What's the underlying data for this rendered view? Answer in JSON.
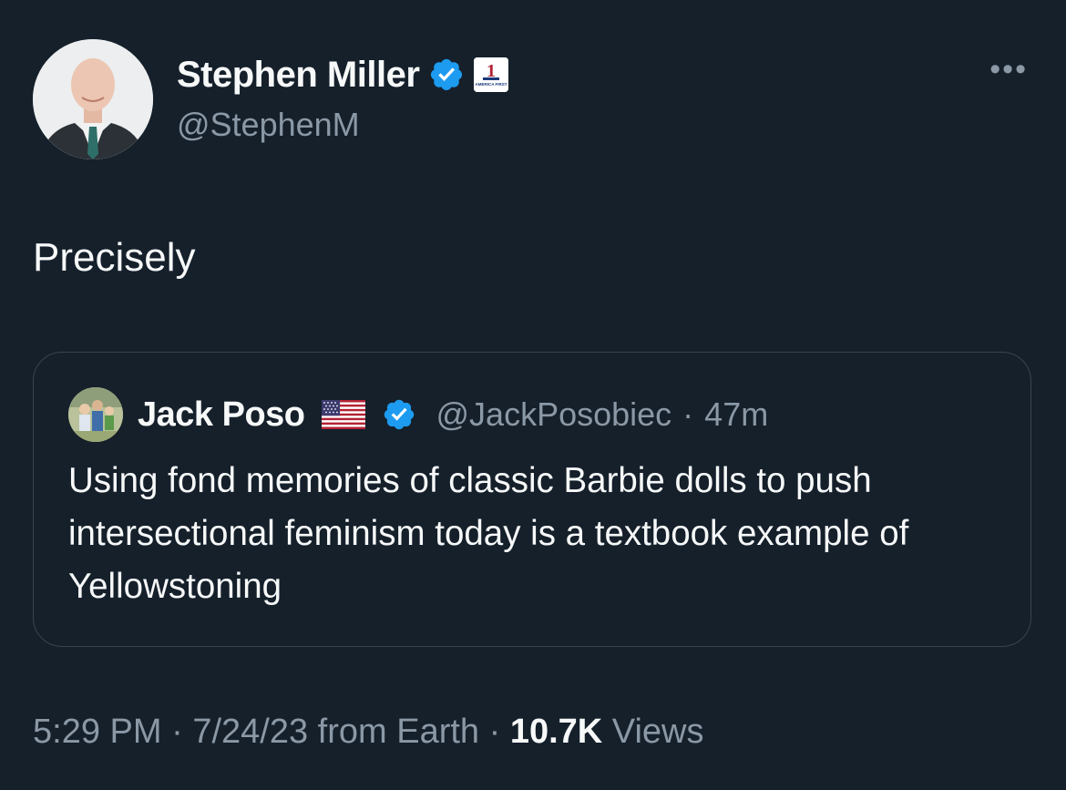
{
  "author": {
    "display_name": "Stephen Miller",
    "handle": "@StephenM",
    "verified_icon": "verified-badge-icon",
    "affiliate_badge_text": "AMERICA FIRST",
    "affiliate_badge_number": "1"
  },
  "tweet": {
    "text": "Precisely"
  },
  "quoted": {
    "display_name": "Jack Poso",
    "flag_icon": "us-flag-icon",
    "handle": "@JackPosobiec",
    "separator": "·",
    "time": "47m",
    "text": "Using fond memories of classic Barbie dolls to push intersectional feminism today is a textbook example of Yellowstoning"
  },
  "meta": {
    "time": "5:29 PM",
    "sep1": " · ",
    "date": "7/24/23",
    "source": " from Earth",
    "sep2": " · ",
    "views_count": "10.7K",
    "views_label": " Views"
  },
  "more_icon": "•••",
  "colors": {
    "background": "#15202b",
    "primary_text": "#f7f9f9",
    "secondary_text": "#8b98a5",
    "border": "#38444d",
    "verified_blue": "#1d9bf0"
  }
}
